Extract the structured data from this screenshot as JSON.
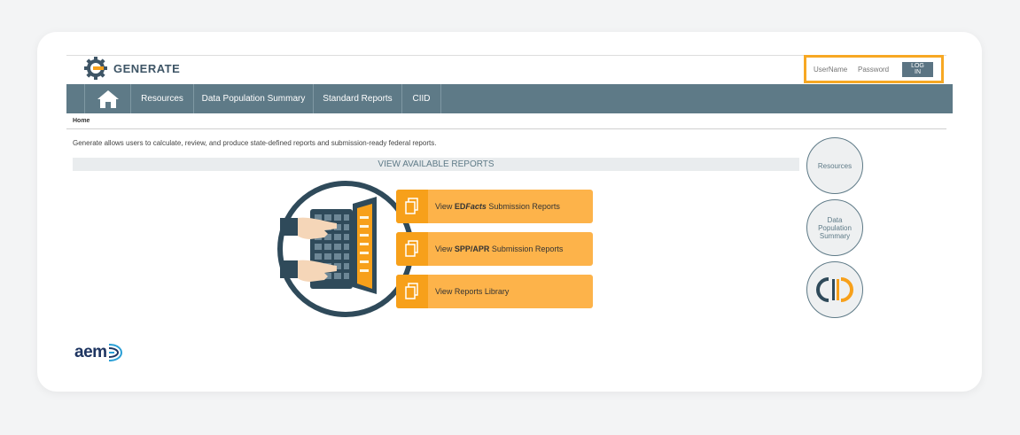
{
  "app": {
    "name": "GENERATE"
  },
  "login": {
    "username_placeholder": "UserName",
    "password_placeholder": "Password",
    "button_label": "LOG IN"
  },
  "nav": {
    "home_icon": "home-icon",
    "items": [
      {
        "label": "Resources"
      },
      {
        "label": "Data Population Summary"
      },
      {
        "label": "Standard Reports"
      },
      {
        "label": "CIID"
      }
    ]
  },
  "breadcrumb": {
    "home": "Home"
  },
  "intro_text": "Generate allows users to calculate, review, and produce state-defined reports and submission-ready federal reports.",
  "view_reports_heading": "VIEW AVAILABLE REPORTS",
  "report_buttons": [
    {
      "prefix": "View ",
      "bold": "ED",
      "italic_bold": "Facts",
      "suffix": " Submission Reports",
      "icon": "document-icon"
    },
    {
      "prefix": "View ",
      "bold": "SPP/APR",
      "italic_bold": "",
      "suffix": " Submission Reports",
      "icon": "document-icon"
    },
    {
      "prefix": "View Reports Library",
      "bold": "",
      "italic_bold": "",
      "suffix": "",
      "icon": "document-icon"
    }
  ],
  "side_circles": {
    "resources": "Resources",
    "data_population_summary": "Data Population Summary",
    "ciid_logo": "ciid-logo"
  },
  "footer_logo": {
    "text": "aem"
  },
  "colors": {
    "nav_bg": "#5e7a87",
    "accent_orange": "#fdb34a",
    "accent_orange_dark": "#f7a01a",
    "login_border": "#f7a823",
    "brand_navy": "#1e3561"
  }
}
